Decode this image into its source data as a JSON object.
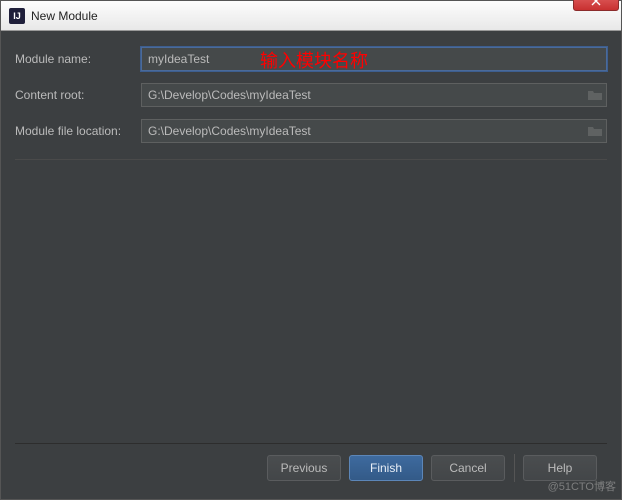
{
  "window": {
    "title": "New Module"
  },
  "form": {
    "module_name_label": "Module name:",
    "module_name_value": "myIdeaTest",
    "content_root_label": "Content root:",
    "content_root_value": "G:\\Develop\\Codes\\myIdeaTest",
    "module_file_location_label": "Module file location:",
    "module_file_location_value": "G:\\Develop\\Codes\\myIdeaTest"
  },
  "annotation": {
    "text": "输入模块名称"
  },
  "buttons": {
    "previous": "Previous",
    "finish": "Finish",
    "cancel": "Cancel",
    "help": "Help"
  },
  "watermark": "@51CTO博客"
}
